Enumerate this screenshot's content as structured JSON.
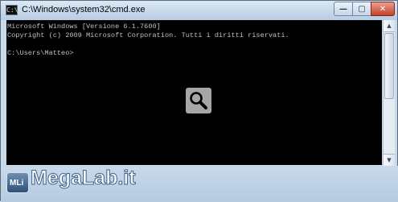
{
  "window": {
    "title": "C:\\Windows\\system32\\cmd.exe",
    "icon": "console-icon",
    "icon_glyph": "C:\\",
    "buttons": {
      "minimize": "—",
      "maximize": "▢",
      "close": "✕"
    }
  },
  "console": {
    "lines": [
      "Microsoft Windows [Versione 6.1.7600]",
      "Copyright (c) 2009 Microsoft Corporation. Tutti i diritti riservati.",
      "",
      "C:\\Users\\Matteo>"
    ]
  },
  "scrollbar": {
    "up": "▲",
    "down": "▼"
  },
  "overlay": {
    "icon": "magnifier-icon"
  },
  "watermark": {
    "logo_text": "MLi",
    "text": "MegaLab.it"
  }
}
